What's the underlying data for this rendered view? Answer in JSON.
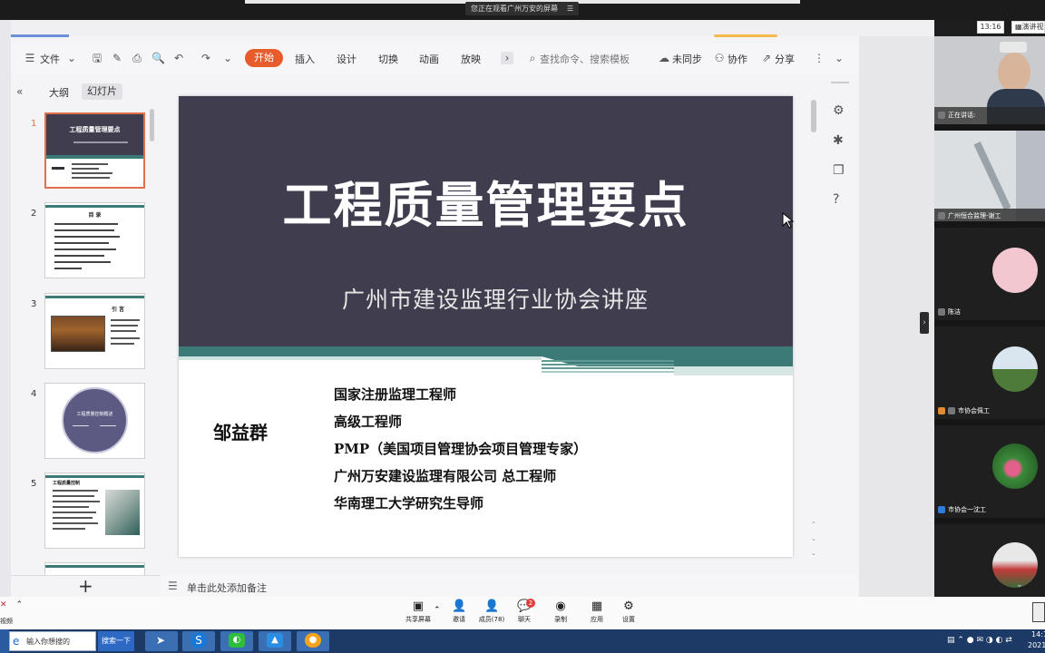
{
  "share_banner": {
    "text": "您正在观看广州万安的屏幕",
    "dots": "☰"
  },
  "meeting_corner": {
    "time": "13:16",
    "present_label": "演讲视"
  },
  "toolbar": {
    "file_menu": "文件",
    "tabs": [
      "开始",
      "插入",
      "设计",
      "切换",
      "动画",
      "放映"
    ],
    "search_placeholder": "查找命令、搜索模板",
    "unsynced": "未同步",
    "collaborate": "协作",
    "share": "分享"
  },
  "sidebar": {
    "tab_outline": "大纲",
    "tab_slides": "幻灯片",
    "add": "+",
    "slides": [
      {
        "num": "1",
        "title": "工程质量管理要点"
      },
      {
        "num": "2",
        "title": "目 录"
      },
      {
        "num": "3",
        "title": "引 言"
      },
      {
        "num": "4",
        "title": "工程质量控制概述"
      },
      {
        "num": "5",
        "title": "工程质量控制"
      }
    ]
  },
  "slide": {
    "title": "工程质量管理要点",
    "subtitle": "广州市建设监理行业协会讲座",
    "speaker": "邹益群",
    "credentials": [
      "国家注册监理工程师",
      "高级工程师",
      "PMP（美国项目管理协会项目管理专家）",
      "广州万安建设监理有限公司 总工程师",
      "华南理工大学研究生导师"
    ]
  },
  "notes_placeholder": "单击此处添加备注",
  "participants": [
    {
      "label": "正在讲话:"
    },
    {
      "label": "广州恒合监理-谢工"
    },
    {
      "label": "陈洁"
    },
    {
      "label": "市协会佩工"
    },
    {
      "label": "市协会一沈工"
    },
    {
      "label": ""
    }
  ],
  "meeting_bar": {
    "video_label": "视频",
    "share_screen": "共享屏幕",
    "invite": "邀请",
    "members": "成员(78)",
    "chat": "聊天",
    "chat_badge": "2",
    "record": "录制",
    "apps": "应用",
    "settings": "设置"
  },
  "taskbar": {
    "search_placeholder": "输入你想搜的",
    "search_button": "搜索一下",
    "clock_time": "14:1",
    "clock_date": "2021"
  },
  "colors": {
    "accent": "#e85c2c",
    "slide_dark": "#3f3d4e",
    "teal": "#3c7a78",
    "taskbar": "#1d3a66"
  }
}
